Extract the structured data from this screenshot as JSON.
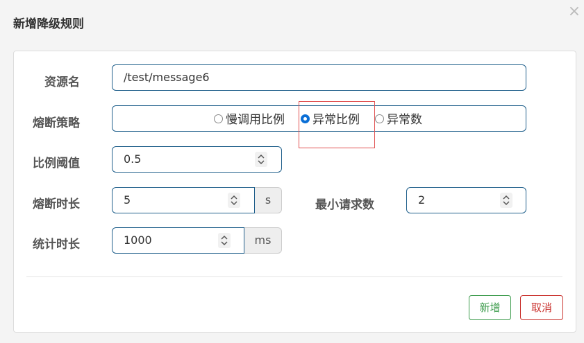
{
  "dialog": {
    "title": "新增降级规则",
    "close_label": "×"
  },
  "form": {
    "resource_label": "资源名",
    "resource_value": "/test/message6",
    "strategy_label": "熔断策略",
    "strategy_options": [
      "慢调用比例",
      "异常比例",
      "异常数"
    ],
    "strategy_selected": "异常比例",
    "ratio_label": "比例阈值",
    "ratio_value": "0.5",
    "break_time_label": "熔断时长",
    "break_time_value": "5",
    "break_time_unit": "s",
    "min_request_label": "最小请求数",
    "min_request_value": "2",
    "stat_time_label": "统计时长",
    "stat_time_value": "1000",
    "stat_time_unit": "ms"
  },
  "actions": {
    "add_label": "新增",
    "cancel_label": "取消"
  },
  "colors": {
    "input_border": "#1f5f8b",
    "radio_checked": "#0a6fd6",
    "add_button": "#3a9a4a",
    "cancel_button": "#c9302c",
    "highlight": "#e05050"
  }
}
